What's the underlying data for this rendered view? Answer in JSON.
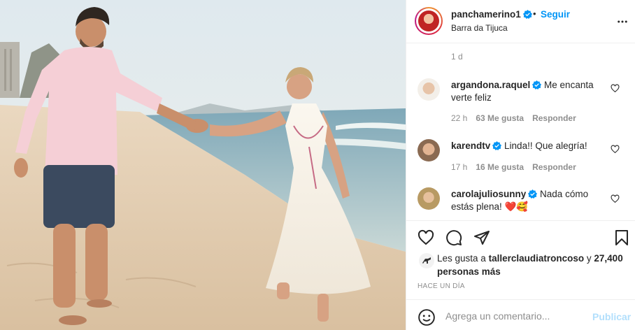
{
  "post": {
    "username": "panchamerino1",
    "separator": "•",
    "follow_label": "Seguir",
    "location": "Barra da Tijuca",
    "posted_ago": "1 d"
  },
  "comments": [
    {
      "username": "argandona.raquel",
      "text": "Me encanta verte feliz",
      "time": "22 h",
      "likes": "63 Me gusta",
      "reply": "Responder"
    },
    {
      "username": "karendtv",
      "text": "Linda!! Que alegría!",
      "time": "17 h",
      "likes": "16 Me gusta",
      "reply": "Responder"
    },
    {
      "username": "carolajuliosunny",
      "text": "Nada cómo estás plena!",
      "emoji": "❤️🥰"
    }
  ],
  "likes": {
    "prefix": "Les gusta a",
    "user": "tallerclaudiatroncoso",
    "conjunction": "y",
    "count": "27,400 personas más"
  },
  "timestamp": "HACE UN DÍA",
  "add_comment": {
    "placeholder": "Agrega un comentario...",
    "publish_label": "Publicar"
  },
  "colors": {
    "accent": "#0095f6",
    "publish_disabled": "#b2dffc",
    "secondary_text": "#8e8e8e",
    "heart_red": "#ed4956"
  },
  "icons": [
    "verified-icon",
    "more-options-icon",
    "heart-icon",
    "comment-icon",
    "share-icon",
    "save-icon",
    "emoji-icon"
  ]
}
